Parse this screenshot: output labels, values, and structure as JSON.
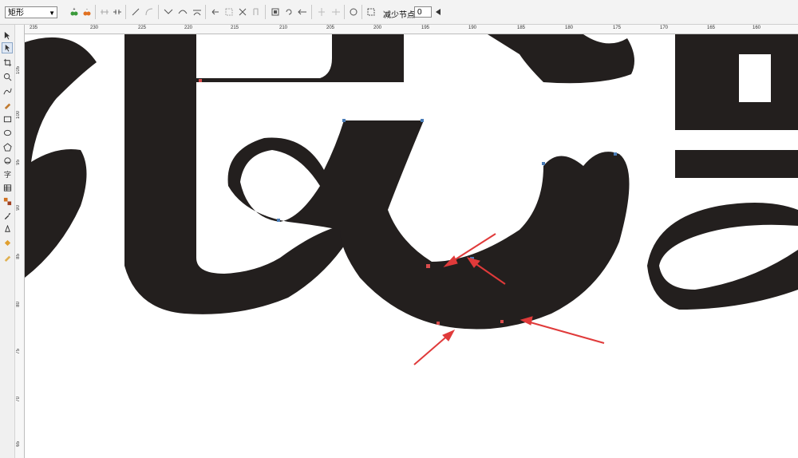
{
  "property_bar": {
    "shape_select": "矩形",
    "reduce_nodes_label": "减少节点",
    "reduce_nodes_value": "0"
  },
  "rulers": {
    "horizontal_ticks": [
      "235",
      "230",
      "225",
      "220",
      "215",
      "210",
      "205",
      "200",
      "195",
      "190",
      "185",
      "180",
      "175",
      "170",
      "165",
      "160"
    ],
    "vertical_ticks": [
      "105",
      "100",
      "95",
      "90",
      "85",
      "80",
      "75",
      "70",
      "65"
    ]
  },
  "colors": {
    "shape_fill": "#231f1e",
    "arrow": "#e03a3a",
    "node_red": "#d94c4c",
    "node_blue": "#4a7db8"
  },
  "tools": [
    "pick-tool-icon",
    "shape-tool-icon",
    "crop-tool-icon",
    "zoom-tool-icon",
    "freehand-tool-icon",
    "smart-fill-icon",
    "rectangle-tool-icon",
    "ellipse-tool-icon",
    "polygon-tool-icon",
    "basic-shapes-icon",
    "text-tool-icon",
    "table-tool-icon",
    "blend-tool-icon",
    "eyedropper-icon",
    "outline-tool-icon",
    "fill-tool-icon",
    "interactive-fill-icon"
  ]
}
